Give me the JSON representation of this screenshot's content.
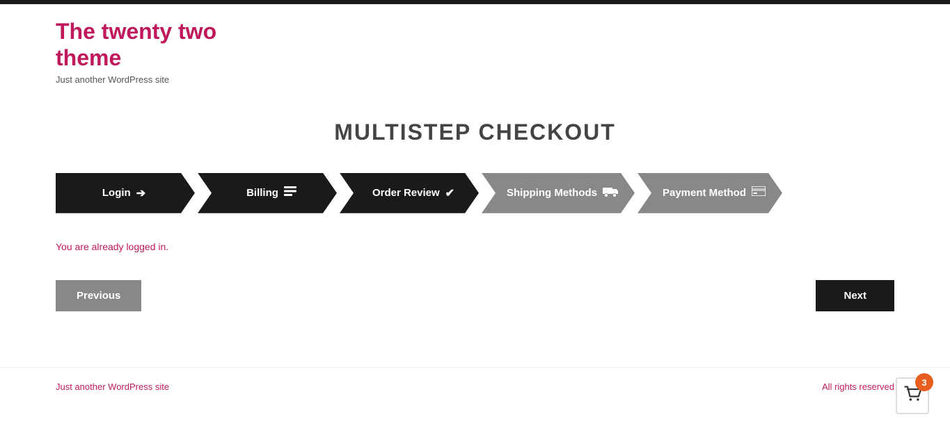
{
  "site": {
    "title_line1": "The twenty two",
    "title_line2": "theme",
    "tagline": "Just another WordPress site"
  },
  "page": {
    "title": "MULTISTEP CHECKOUT"
  },
  "steps": [
    {
      "id": "login",
      "label": "Login",
      "icon": "→",
      "style": "dark",
      "active": true
    },
    {
      "id": "billing",
      "label": "Billing",
      "icon": "☰",
      "style": "dark",
      "active": false
    },
    {
      "id": "order-review",
      "label": "Order Review",
      "icon": "✔",
      "style": "dark",
      "active": false
    },
    {
      "id": "shipping",
      "label": "Shipping Methods",
      "icon": "🚚",
      "style": "gray",
      "active": false
    },
    {
      "id": "payment",
      "label": "Payment Method",
      "icon": "💳",
      "style": "gray",
      "active": false
    }
  ],
  "message": {
    "already_logged": "You are already logged in."
  },
  "buttons": {
    "previous": "Previous",
    "next": "Next"
  },
  "footer": {
    "left": "Just another WordPress site",
    "right": "All rights reserved"
  },
  "cart": {
    "count": "3"
  }
}
